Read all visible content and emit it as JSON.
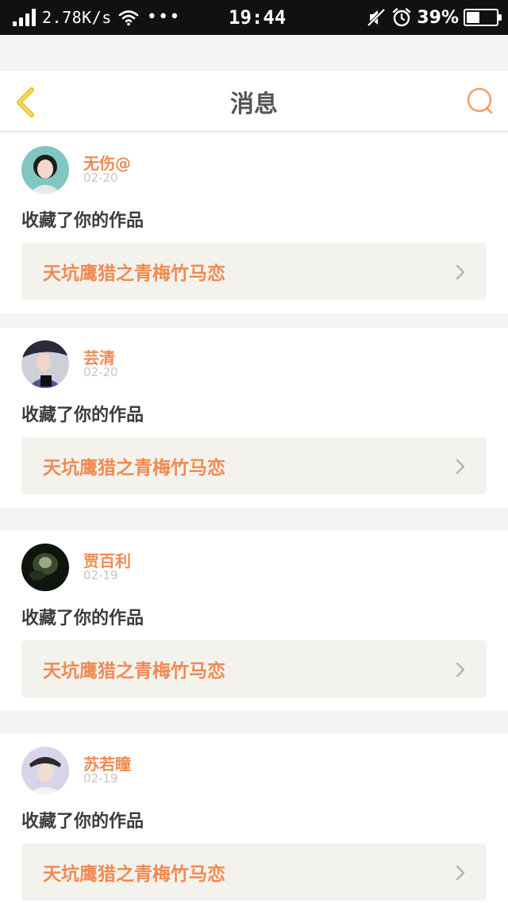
{
  "status_bar": {
    "net_speed": "2.78K/s",
    "dots": "•••",
    "time": "19:44",
    "battery_percent": "39%",
    "battery_level": 0.39,
    "icons": [
      "signal-icon",
      "wifi-icon",
      "mute-icon",
      "alarm-icon",
      "battery-icon"
    ]
  },
  "header": {
    "title": "消息",
    "back_icon": "chevron-left-icon",
    "search_icon": "search-icon"
  },
  "colors": {
    "accent": "#f08a52",
    "back_icon": "#e8c21f",
    "text_dark": "#3c3c3c",
    "date_gray": "#c4c4c4",
    "work_bg": "#f3f2ec"
  },
  "messages": [
    {
      "username": "无伤@",
      "date": "02-20",
      "action": "收藏了你的作品",
      "work_title": "天坑鹰猎之青梅竹马恋"
    },
    {
      "username": "芸清",
      "date": "02-20",
      "action": "收藏了你的作品",
      "work_title": "天坑鹰猎之青梅竹马恋"
    },
    {
      "username": "贾百利",
      "date": "02-19",
      "action": "收藏了你的作品",
      "work_title": "天坑鹰猎之青梅竹马恋"
    },
    {
      "username": "苏若瞳",
      "date": "02-19",
      "action": "收藏了你的作品",
      "work_title": "天坑鹰猎之青梅竹马恋"
    }
  ]
}
